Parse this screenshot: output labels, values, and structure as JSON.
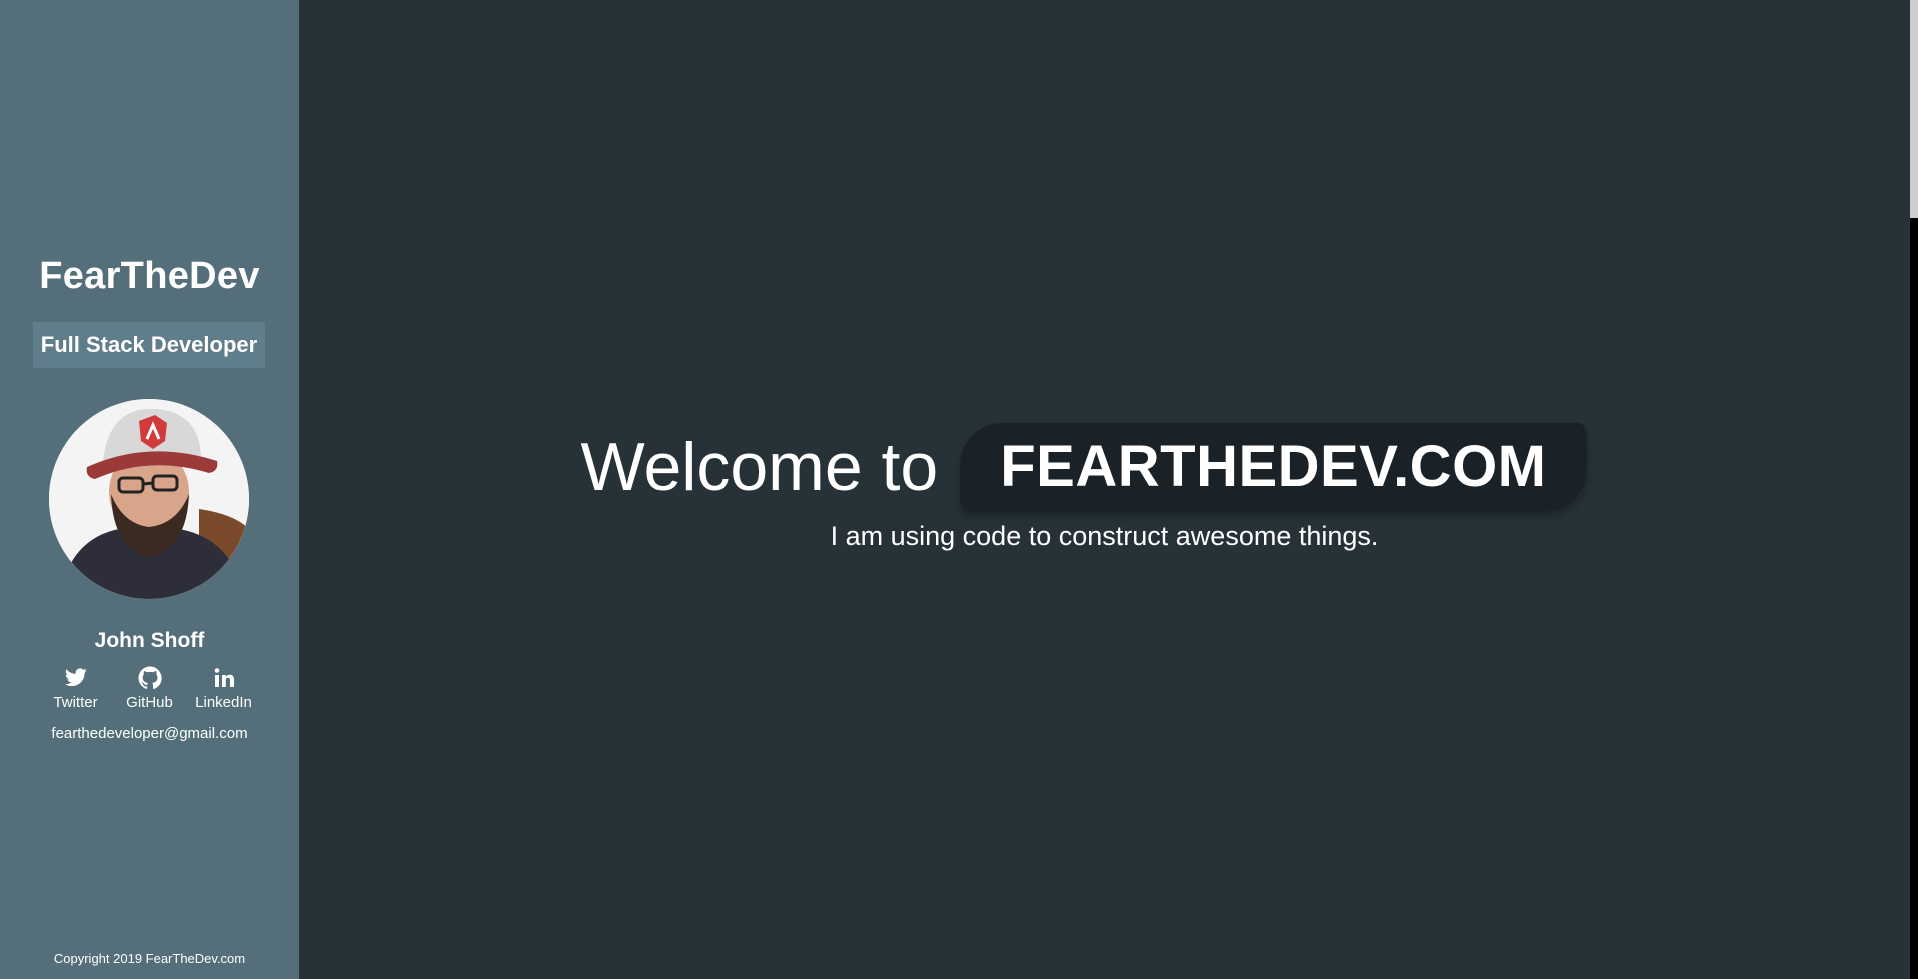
{
  "sidebar": {
    "brand": "FearTheDev",
    "role": "Full Stack Developer",
    "author_name": "John Shoff",
    "social": [
      {
        "label": "Twitter",
        "icon": "twitter-icon"
      },
      {
        "label": "GitHub",
        "icon": "github-icon"
      },
      {
        "label": "LinkedIn",
        "icon": "linkedin-icon"
      }
    ],
    "email": "fearthedeveloper@gmail.com",
    "copyright": "Copyright 2019 FearTheDev.com"
  },
  "main": {
    "welcome_text": "Welcome to",
    "domain_text": "FEARTHEDEV.COM",
    "tagline": "I am using code to construct awesome things."
  },
  "colors": {
    "sidebar_bg": "#546e7a",
    "badge_bg": "#607d8b",
    "main_bg": "#263238",
    "pill_bg": "#1b2227",
    "text": "#ffffff"
  }
}
